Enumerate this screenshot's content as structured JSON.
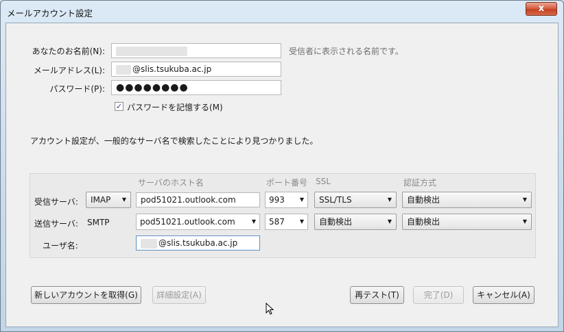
{
  "window": {
    "title": "メールアカウント設定",
    "close_glyph": "x"
  },
  "form": {
    "name_label": "あなたのお名前(N):",
    "name_value": "",
    "name_hint": "受信者に表示される名前です。",
    "email_label": "メールアドレス(L):",
    "email_value": "@slis.tsukuba.ac.jp",
    "password_label": "パスワード(P):",
    "password_value": "●●●●●●●●",
    "remember_label": "パスワードを記憶する(M)",
    "remember_checked": true,
    "remember_check_glyph": "✓"
  },
  "status_message": "アカウント設定が、一般的なサーバ名で検索したことにより見つかりました。",
  "server": {
    "headers": {
      "host": "サーバのホスト名",
      "port": "ポート番号",
      "ssl": "SSL",
      "auth": "認証方式"
    },
    "incoming": {
      "label": "受信サーバ:",
      "protocol": "IMAP",
      "host": "pod51021.outlook.com",
      "port": "993",
      "ssl": "SSL/TLS",
      "auth": "自動検出"
    },
    "outgoing": {
      "label": "送信サーバ:",
      "protocol": "SMTP",
      "host": "pod51021.outlook.com",
      "port": "587",
      "ssl": "自動検出",
      "auth": "自動検出"
    },
    "username": {
      "label": "ユーザ名:",
      "value": "@slis.tsukuba.ac.jp"
    }
  },
  "buttons": {
    "get_account": "新しいアカウントを取得(G)",
    "advanced": "詳細設定(A)",
    "retest": "再テスト(T)",
    "done": "完了(D)",
    "cancel": "キャンセル(A)"
  },
  "icons": {
    "dropdown": "▼"
  }
}
